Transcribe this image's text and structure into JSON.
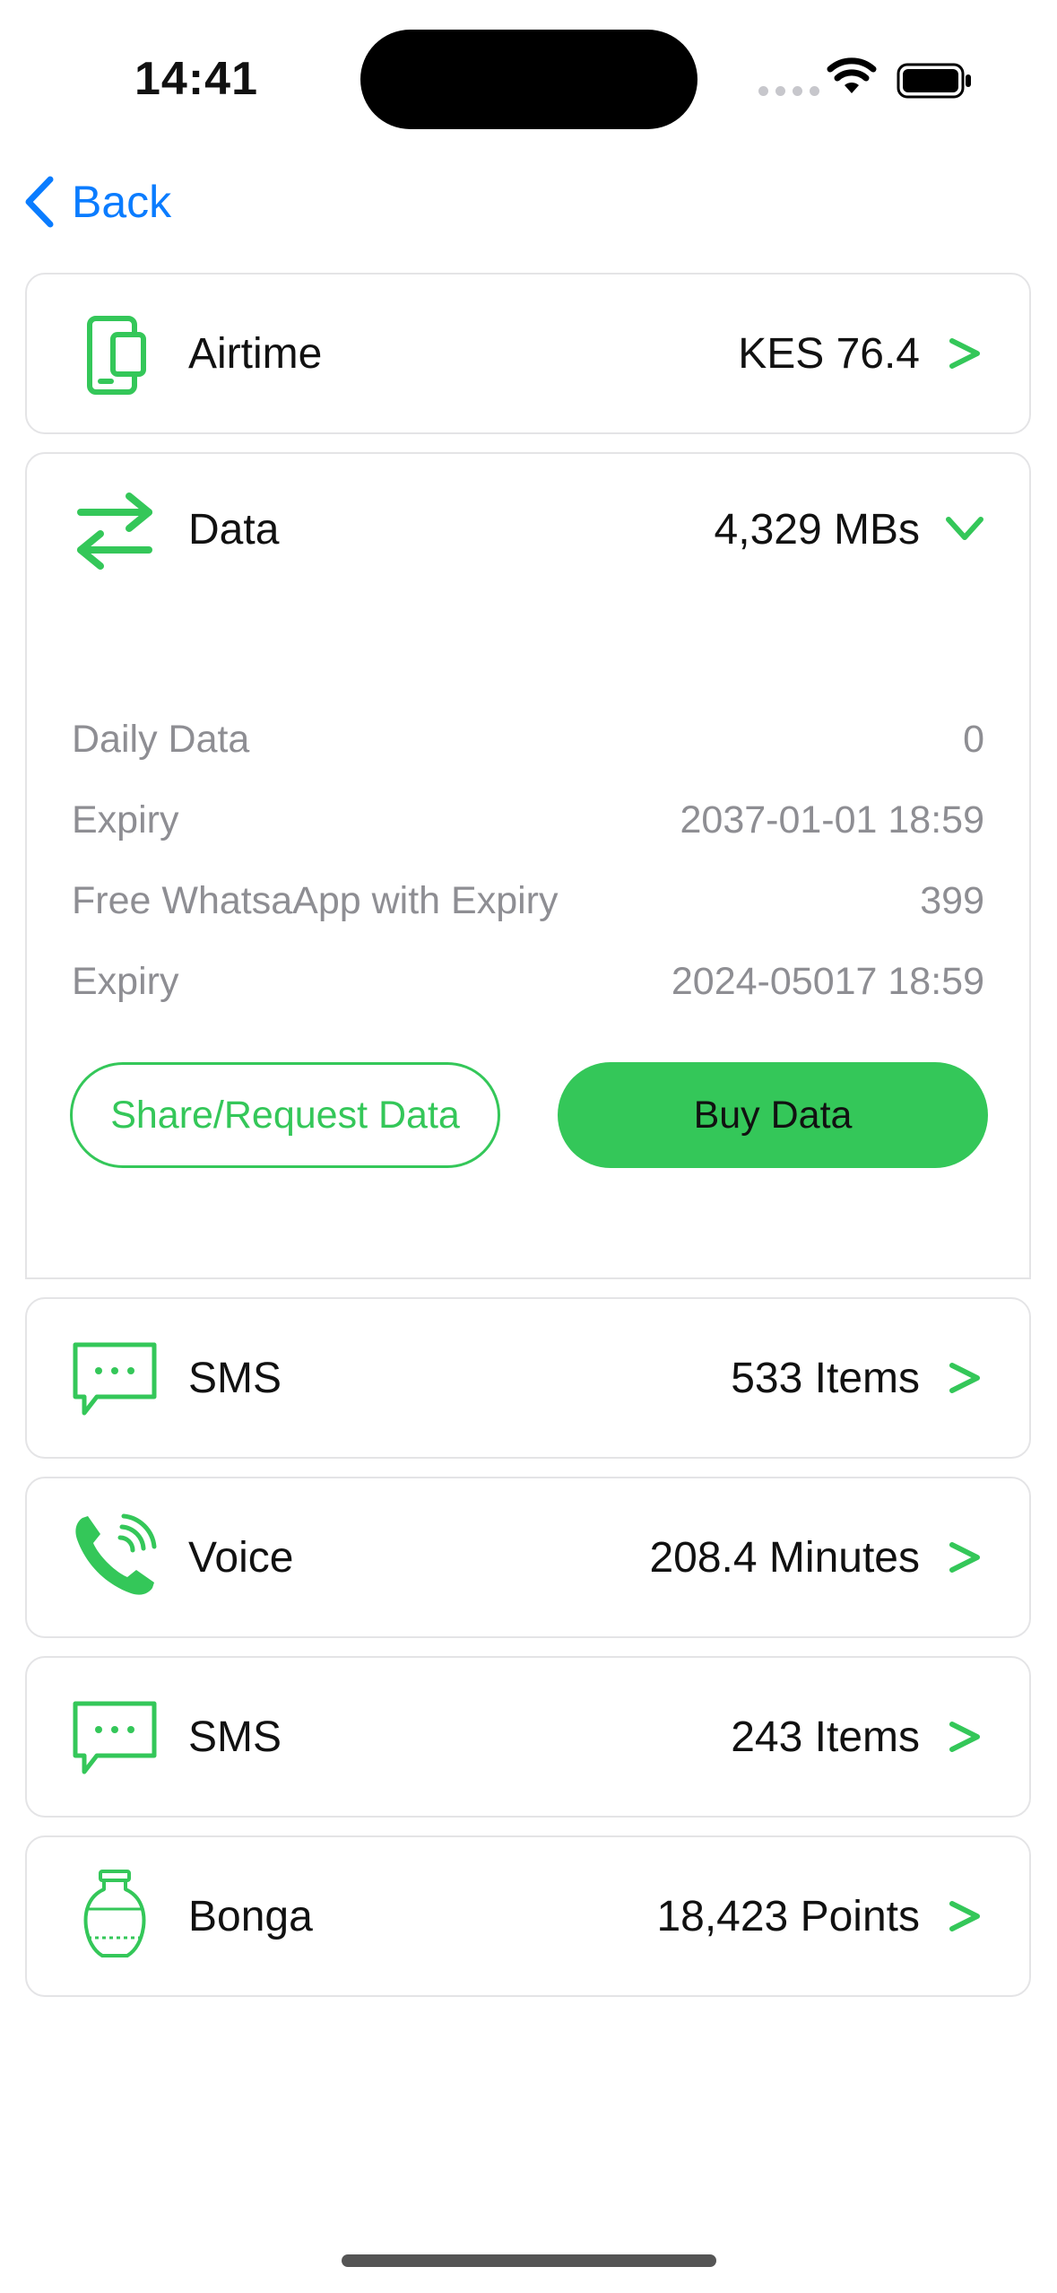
{
  "status_bar": {
    "time": "14:41"
  },
  "nav": {
    "back_label": "Back"
  },
  "colors": {
    "accent": "#34c759",
    "link": "#0a7cff",
    "muted": "#8e8e93"
  },
  "items": [
    {
      "label": "Airtime",
      "value": "KES 76.4",
      "icon": "phone-card-icon"
    },
    {
      "label": "Data",
      "value": "4,329 MBs",
      "icon": "transfer-arrows-icon"
    },
    {
      "label": "SMS",
      "value": "533 Items",
      "icon": "message-bubble-icon"
    },
    {
      "label": "Voice",
      "value": "208.4 Minutes",
      "icon": "phone-call-icon"
    },
    {
      "label": "SMS",
      "value": "243 Items",
      "icon": "message-bubble-icon"
    },
    {
      "label": "Bonga",
      "value": "18,423 Points",
      "icon": "vase-icon"
    }
  ],
  "data_details": {
    "rows": [
      {
        "label": "Daily Data",
        "value": "0"
      },
      {
        "label": "Expiry",
        "value": "2037-01-01 18:59"
      },
      {
        "label": "Free WhatsaApp with Expiry",
        "value": "399"
      },
      {
        "label": "Expiry",
        "value": "2024-05017 18:59"
      }
    ],
    "share_button": "Share/Request Data",
    "buy_button": "Buy Data"
  }
}
